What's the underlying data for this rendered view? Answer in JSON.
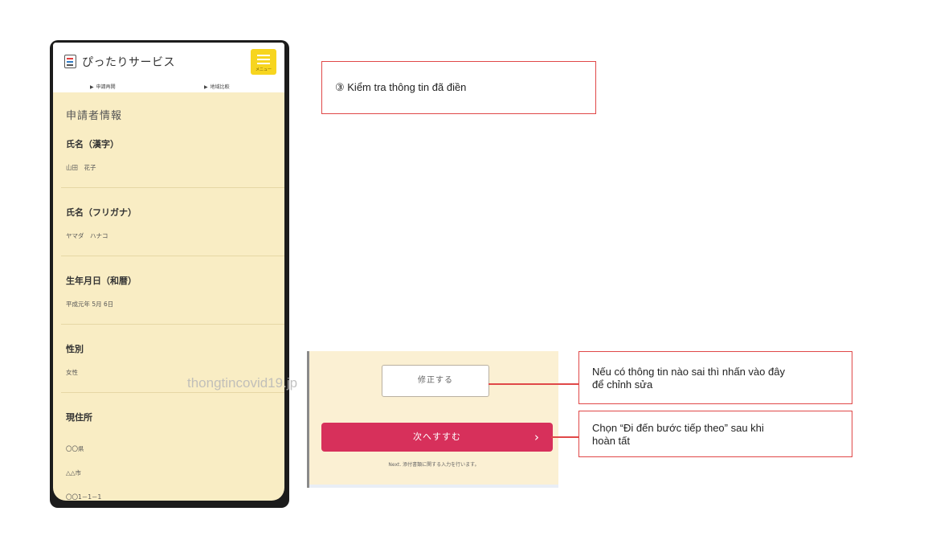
{
  "phone": {
    "app_title": "ぴったりサービス",
    "menu_label": "メニュー",
    "subnav": [
      "申請再開",
      "地域比較"
    ],
    "section_title": "申請者情報",
    "fields": [
      {
        "label": "氏名（漢字）",
        "value": "山田　花子"
      },
      {
        "label": "氏名（フリガナ）",
        "value": "ヤマダ　ハナコ"
      },
      {
        "label": "生年月日（和暦）",
        "value": "平成元年 5月 6日"
      },
      {
        "label": "性別",
        "value": "女性"
      },
      {
        "label": "現住所",
        "values": [
          "〇〇県",
          "△△市",
          "〇〇1－1－1"
        ]
      }
    ]
  },
  "callouts": {
    "step": "③ Kiểm tra thông tin đã điền",
    "edit_line1": "Nếu có thông tin nào sai thì nhấn vào đây",
    "edit_line2": "để chỉnh  sửa",
    "next_line1": "Chọn “Đi đến bước tiếp theo” sau khi",
    "next_line2": "hoàn tất"
  },
  "buttons": {
    "edit_label": "修正する",
    "next_label": "次へすすむ",
    "next_chevron": "›",
    "next_note": "Next. 添付書類に関する入力を行います。"
  },
  "watermark": "thongtincovid19.jp",
  "colors": {
    "accent_red": "#e04848",
    "next_button": "#d7305b",
    "menu_yellow": "#f7d51f",
    "panel_bg": "#f9edc4"
  }
}
